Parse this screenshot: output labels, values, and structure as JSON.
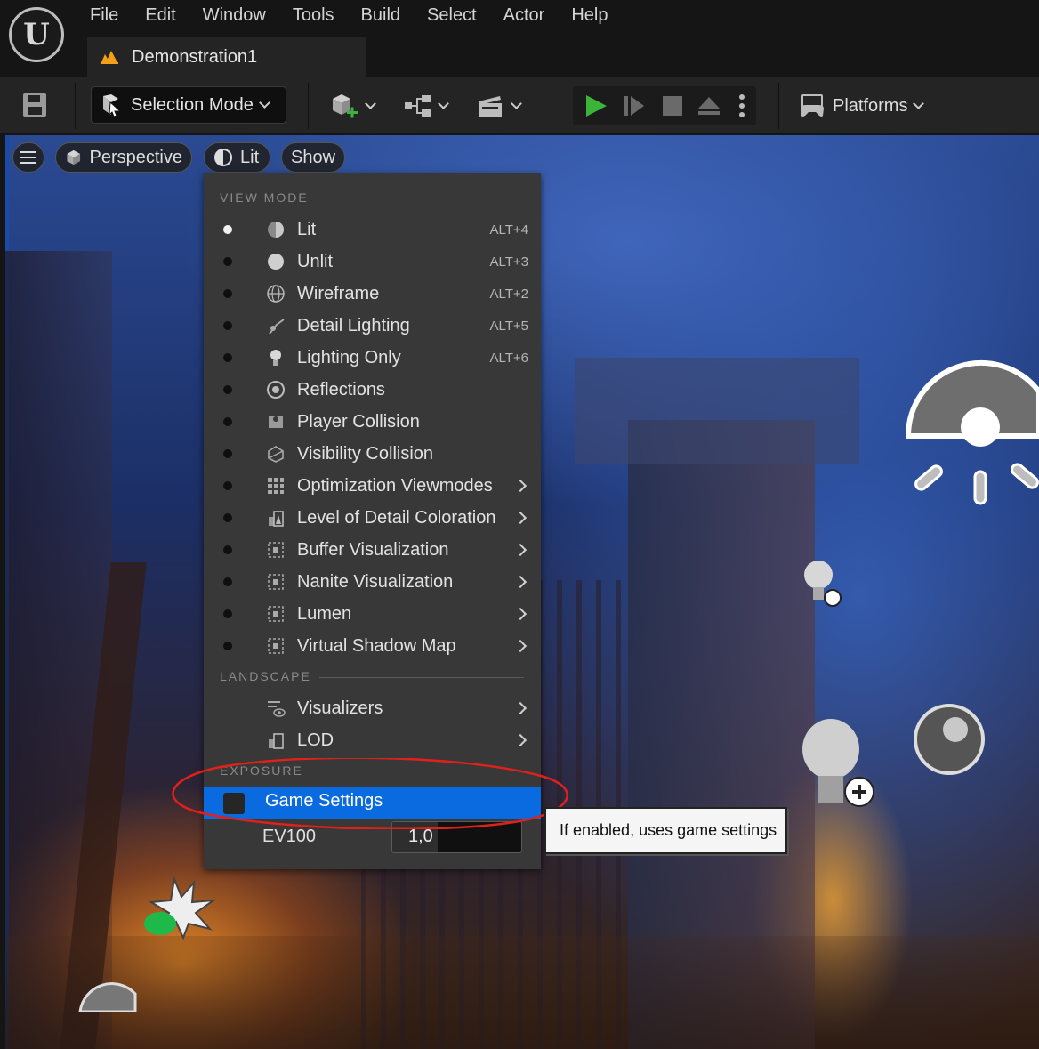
{
  "menubar": {
    "items": [
      "File",
      "Edit",
      "Window",
      "Tools",
      "Build",
      "Select",
      "Actor",
      "Help"
    ]
  },
  "document_tab": {
    "label": "Demonstration1"
  },
  "toolbar": {
    "selection_mode": "Selection Mode",
    "platforms": "Platforms"
  },
  "viewport_bar": {
    "perspective": "Perspective",
    "view_mode": "Lit",
    "show": "Show"
  },
  "dropdown": {
    "view_mode_header": "VIEW MODE",
    "view_modes": [
      {
        "label": "Lit",
        "shortcut": "ALT+4",
        "icon": "lit-sphere-icon",
        "selected": true,
        "submenu": false
      },
      {
        "label": "Unlit",
        "shortcut": "ALT+3",
        "icon": "unlit-sphere-icon",
        "selected": false,
        "submenu": false
      },
      {
        "label": "Wireframe",
        "shortcut": "ALT+2",
        "icon": "wireframe-sphere-icon",
        "selected": false,
        "submenu": false
      },
      {
        "label": "Detail Lighting",
        "shortcut": "ALT+5",
        "icon": "detail-lighting-icon",
        "selected": false,
        "submenu": false
      },
      {
        "label": "Lighting Only",
        "shortcut": "ALT+6",
        "icon": "lightbulb-icon",
        "selected": false,
        "submenu": false
      },
      {
        "label": "Reflections",
        "shortcut": "",
        "icon": "reflections-icon",
        "selected": false,
        "submenu": false
      },
      {
        "label": "Player Collision",
        "shortcut": "",
        "icon": "player-collision-icon",
        "selected": false,
        "submenu": false
      },
      {
        "label": "Visibility Collision",
        "shortcut": "",
        "icon": "visibility-collision-icon",
        "selected": false,
        "submenu": false
      },
      {
        "label": "Optimization Viewmodes",
        "shortcut": "",
        "icon": "grid-icon",
        "selected": false,
        "submenu": true
      },
      {
        "label": "Level of Detail Coloration",
        "shortcut": "",
        "icon": "lod-coloration-icon",
        "selected": false,
        "submenu": true
      },
      {
        "label": "Buffer Visualization",
        "shortcut": "",
        "icon": "buffer-icon",
        "selected": false,
        "submenu": true
      },
      {
        "label": "Nanite Visualization",
        "shortcut": "",
        "icon": "buffer-icon",
        "selected": false,
        "submenu": true
      },
      {
        "label": "Lumen",
        "shortcut": "",
        "icon": "buffer-icon",
        "selected": false,
        "submenu": true
      },
      {
        "label": "Virtual Shadow Map",
        "shortcut": "",
        "icon": "buffer-icon",
        "selected": false,
        "submenu": true
      }
    ],
    "landscape_header": "LANDSCAPE",
    "landscape_items": [
      {
        "label": "Visualizers",
        "icon": "visualizers-icon",
        "submenu": true
      },
      {
        "label": "LOD",
        "icon": "lod-icon",
        "submenu": true
      }
    ],
    "exposure_header": "EXPOSURE",
    "game_settings": {
      "label": "Game Settings",
      "checked": false
    },
    "ev100": {
      "label": "EV100",
      "value": "1,0",
      "fill_fraction": 0.35
    }
  },
  "tooltip": {
    "text": "If enabled, uses game settings"
  },
  "colors": {
    "highlight": "#0a6be0",
    "annotation": "#e0201a",
    "play": "#3ab53a"
  }
}
